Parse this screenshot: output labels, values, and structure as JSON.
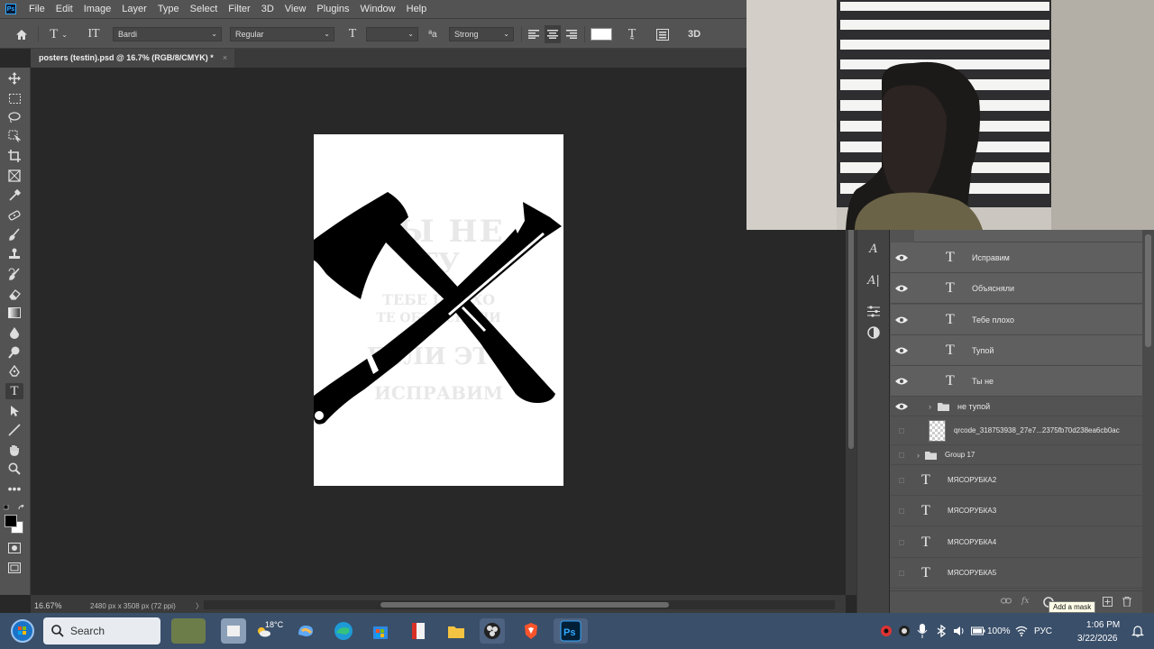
{
  "menu": {
    "logo": "Ps",
    "items": [
      "File",
      "Edit",
      "Image",
      "Layer",
      "Type",
      "Select",
      "Filter",
      "3D",
      "View",
      "Plugins",
      "Window",
      "Help"
    ]
  },
  "options": {
    "font_family": "Bardi",
    "font_style": "Regular",
    "font_size": "",
    "antialias": "Strong",
    "color_swatch": "#ffffff",
    "mode_3d": "3D"
  },
  "document": {
    "tab_title": "posters (testin).psd @ 16.7% (RGB/8/CMYK) *",
    "close_glyph": "×",
    "ghost_lines": [
      "ТЫ НЕ",
      "ТУ",
      "ТЕБЕ ПЛОХО",
      "ТЕ ОБЪЯСНЯЛИ",
      "ЕСЛИ ЭТО",
      "ИСПРАВИМ"
    ]
  },
  "status": {
    "zoom": "16.67%",
    "doc_info": "2480 px x 3508 px (72 ppi)",
    "arrow": "〉"
  },
  "layers": {
    "items": [
      {
        "name": "Исправим",
        "kind": "text",
        "visible": true,
        "selected": true
      },
      {
        "name": "Объясняли",
        "kind": "text",
        "visible": true,
        "selected": true
      },
      {
        "name": "Тебе плохо",
        "kind": "text",
        "visible": true,
        "selected": true
      },
      {
        "name": "Тупой",
        "kind": "text",
        "visible": true,
        "selected": true
      },
      {
        "name": "Ты не",
        "kind": "text",
        "visible": true,
        "selected": true
      },
      {
        "name": "не тупой",
        "kind": "group",
        "visible": true,
        "selected": false
      },
      {
        "name": "qrcode_318753938_27e7...2375fb70d238ea6cb0ac",
        "kind": "smart",
        "visible": false,
        "selected": false
      },
      {
        "name": "Group 17",
        "kind": "group",
        "visible": false,
        "selected": false
      },
      {
        "name": "МЯСОРУБКА2",
        "kind": "text",
        "visible": false,
        "selected": false
      },
      {
        "name": "МЯСОРУБКА3",
        "kind": "text",
        "visible": false,
        "selected": false
      },
      {
        "name": "МЯСОРУБКА4",
        "kind": "text",
        "visible": false,
        "selected": false
      },
      {
        "name": "МЯСОРУБКА5",
        "kind": "text",
        "visible": false,
        "selected": false
      }
    ],
    "tooltip": "Add a mask",
    "footer_icons": [
      "link-icon",
      "fx-icon",
      "mask-icon",
      "new-layer-icon",
      "trash-icon"
    ],
    "footer_fx": "fx"
  },
  "taskbar": {
    "search_placeholder": "Search",
    "weather": "18°C",
    "battery": "100%",
    "lang": "РУС",
    "time": "1:06 PM",
    "date": "3/22/2026"
  }
}
